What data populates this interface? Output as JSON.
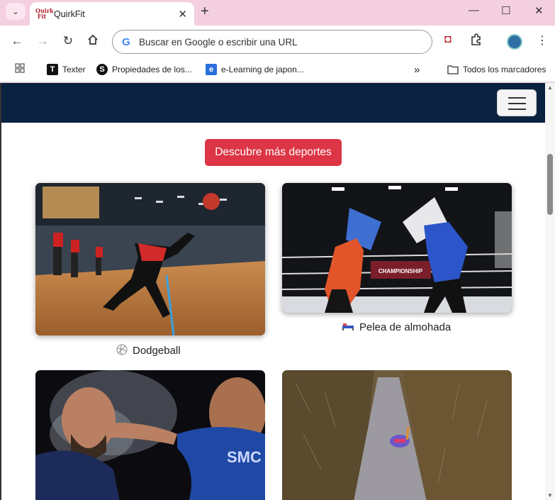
{
  "browser": {
    "tab_title": "QuirkFit",
    "favicon_text": "Quirk Fit",
    "omnibox_placeholder": "Buscar en Google o escribir una URL",
    "bookmarks": [
      {
        "label": "Texter",
        "icon": "texter-icon"
      },
      {
        "label": "Propiedades de los...",
        "icon": "s-icon"
      },
      {
        "label": "e-Learning de japon...",
        "icon": "elearning-icon"
      }
    ],
    "bookmarks_overflow": "»",
    "all_bookmarks_label": "Todos los marcadores"
  },
  "page": {
    "cta_label": "Descubre más deportes",
    "cards": [
      {
        "label": "Dodgeball",
        "icon": "volleyball-icon",
        "image": "dodgeball-photo"
      },
      {
        "label": "Pelea de almohada",
        "icon": "bed-icon",
        "image": "pillow-fight-photo"
      },
      {
        "label": "",
        "icon": "",
        "image": "slap-fight-photo"
      },
      {
        "label": "",
        "icon": "",
        "image": "bog-snorkelling-photo"
      }
    ]
  },
  "colors": {
    "tab_strip": "#f4cfe0",
    "site_nav": "#0a2240",
    "cta": "#dc3545"
  }
}
